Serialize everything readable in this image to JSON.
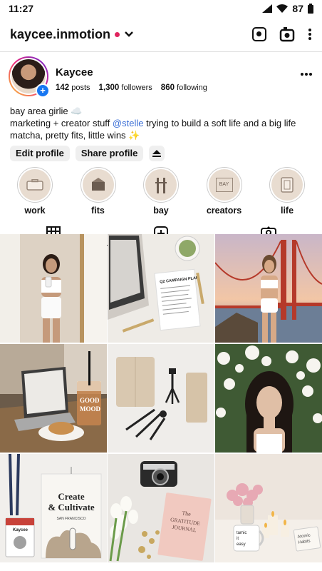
{
  "status": {
    "time": "11:27",
    "battery": "87"
  },
  "header": {
    "username": "kaycee.inmotion"
  },
  "profile": {
    "name": "Kaycee",
    "posts_count": "142",
    "posts_label": "posts",
    "followers_count": "1,300",
    "followers_label": "followers",
    "following_count": "860",
    "following_label": "following"
  },
  "bio": {
    "line1": "bay area girlie ☁️",
    "line2_pre": "marketing + creator stuff ",
    "line2_mention": "@stelle",
    "line2_post": " trying to build a soft life and a big life",
    "line3": "matcha, pretty fits, little wins ✨"
  },
  "buttons": {
    "edit": "Edit profile",
    "share": "Share profile"
  },
  "highlights": [
    {
      "label": "work"
    },
    {
      "label": "fits"
    },
    {
      "label": "bay"
    },
    {
      "label": "creators"
    },
    {
      "label": "life"
    }
  ],
  "hl_bay_text": "BAY",
  "posts": {
    "campaign_title": "Q2 CAMPAIGN PLAN",
    "cup_text_1": "GOOD",
    "cup_text_2": "MOOD",
    "book1_line1": "Create",
    "book1_line2": "& Cultivate",
    "book1_line3": "SAN FRANCISCO",
    "badge_name": "Kaycee",
    "journal_line1": "The",
    "journal_line2": "GRATITUDE",
    "journal_line3": "JOURNAL",
    "mug_line1": "tamic",
    "mug_line2": "it",
    "mug_line3": "easy",
    "book2_line1": "Atomic",
    "book2_line2": "Habits"
  }
}
